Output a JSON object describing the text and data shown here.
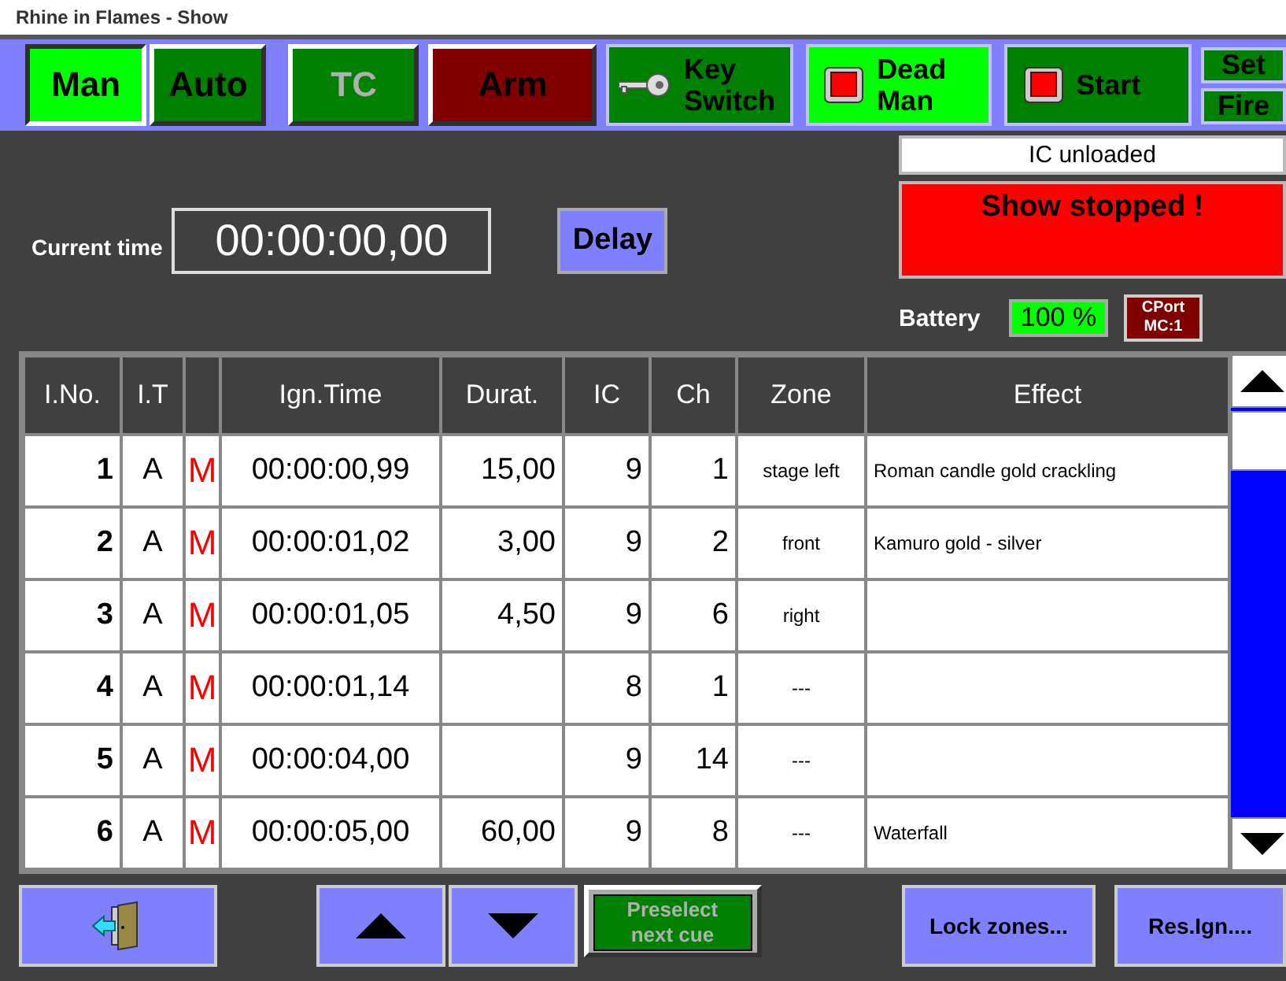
{
  "window": {
    "title": "Rhine in Flames - Show"
  },
  "toolbar": [
    {
      "label": "Man",
      "kind": "mode",
      "on": true,
      "disabled": false
    },
    {
      "label": "Auto",
      "kind": "mode",
      "on": false,
      "disabled": false
    },
    {
      "label": "TC",
      "kind": "mode",
      "on": false,
      "disabled": true
    },
    {
      "label": "Arm",
      "kind": "arm",
      "on": false,
      "disabled": false
    },
    {
      "label": "Key Switch",
      "kind": "key",
      "on": false,
      "disabled": false
    },
    {
      "label": "Dead Man",
      "kind": "lamp",
      "on": true,
      "disabled": false
    },
    {
      "label": "Start",
      "kind": "lamp",
      "on": false,
      "disabled": false
    },
    {
      "label": "Set",
      "kind": "stack",
      "on": false,
      "disabled": false
    },
    {
      "label": "Fire",
      "kind": "stack",
      "on": false,
      "disabled": false
    }
  ],
  "clock": {
    "label": "Current time",
    "value": "00:00:00,00",
    "delay_button": "Delay"
  },
  "status": {
    "ic": "IC unloaded",
    "show": "Show stopped !",
    "battery_label": "Battery",
    "battery": "100 %",
    "port": "CPort MC:1"
  },
  "table": {
    "headers": {
      "no": "I.No.",
      "it": "I.T",
      "time": "Ign.Time",
      "duration": "Durat.",
      "ic": "IC",
      "ch": "Ch",
      "zone": "Zone",
      "effect": "Effect"
    },
    "rows": [
      {
        "no": "1",
        "it": "A",
        "mark": "M",
        "time": "00:00:00,99",
        "duration": "15,00",
        "ic": "9",
        "ch": "1",
        "zone": "stage left",
        "effect": "Roman candle gold crackling"
      },
      {
        "no": "2",
        "it": "A",
        "mark": "M",
        "time": "00:00:01,02",
        "duration": "3,00",
        "ic": "9",
        "ch": "2",
        "zone": "front",
        "effect": "Kamuro gold - silver"
      },
      {
        "no": "3",
        "it": "A",
        "mark": "M",
        "time": "00:00:01,05",
        "duration": "4,50",
        "ic": "9",
        "ch": "6",
        "zone": "right"
      },
      {
        "no": "4",
        "it": "A",
        "mark": "M",
        "time": "00:00:01,14",
        "ic": "8",
        "ch": "1",
        "zone": "---"
      },
      {
        "no": "5",
        "it": "A",
        "mark": "M",
        "time": "00:00:04,00",
        "ic": "9",
        "ch": "14",
        "zone": "---"
      },
      {
        "no": "6",
        "it": "A",
        "mark": "M",
        "time": "00:00:05,00",
        "duration": "60,00",
        "ic": "9",
        "ch": "8",
        "zone": "---",
        "effect": "Waterfall"
      }
    ]
  },
  "footer": {
    "preselect": {
      "label": "Preselect next cue",
      "disabled": true
    },
    "lock_zones": "Lock zones...",
    "reset_ignition": "Res.Ign...."
  }
}
